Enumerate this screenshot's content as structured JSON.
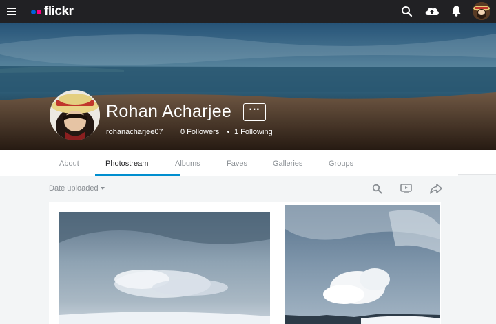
{
  "app": {
    "logo_text": "flickr"
  },
  "topbar": {
    "icons": [
      "menu-icon",
      "search-icon",
      "upload-cloud-icon",
      "bell-icon",
      "avatar"
    ]
  },
  "profile": {
    "name": "Rohan Acharjee",
    "username": "rohanacharjee07",
    "followers": "0 Followers",
    "following": "1 Following",
    "more_label": "···"
  },
  "tabs": [
    {
      "label": "About",
      "active": false
    },
    {
      "label": "Photostream",
      "active": true
    },
    {
      "label": "Albums",
      "active": false
    },
    {
      "label": "Faves",
      "active": false
    },
    {
      "label": "Galleries",
      "active": false
    },
    {
      "label": "Groups",
      "active": false
    }
  ],
  "toolbar": {
    "sort_label": "Date uploaded",
    "icons": [
      "search-icon",
      "slideshow-icon",
      "share-icon"
    ]
  },
  "colors": {
    "topbar": "#212124",
    "accent": "#008ecf",
    "flickr_blue": "#0063dc",
    "flickr_pink": "#ff0084"
  }
}
